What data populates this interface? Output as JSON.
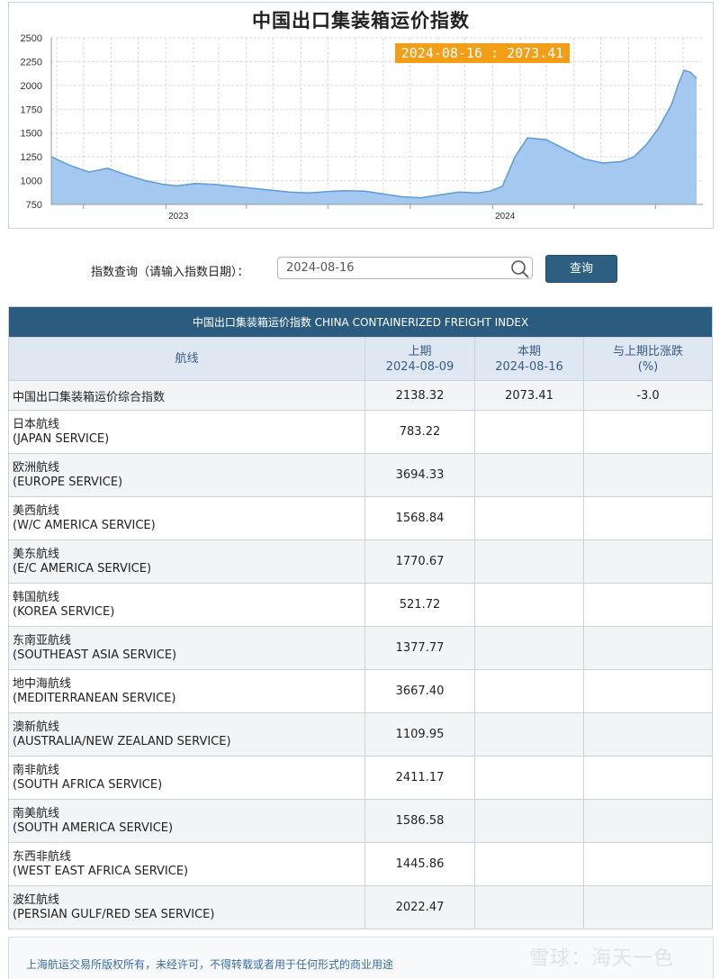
{
  "chart": {
    "title": "中国出口集装箱运价指数",
    "tooltip": "2024-08-16 : 2073.41"
  },
  "chart_data": {
    "type": "area",
    "title": "中国出口集装箱运价指数",
    "ylim": [
      750,
      2500
    ],
    "yticks": [
      750,
      1000,
      1250,
      1500,
      1750,
      2000,
      2250,
      2500
    ],
    "xtick_labels": [
      "2023",
      "2024"
    ],
    "grid": true,
    "color": "#a4c8f0",
    "series": [
      {
        "x": [
          "2022-08-26",
          "2022-09-16",
          "2022-10-07",
          "2022-10-28",
          "2022-11-18",
          "2022-12-09",
          "2022-12-30",
          "2023-01-13",
          "2023-02-03",
          "2023-02-24",
          "2023-03-17",
          "2023-04-07",
          "2023-04-28",
          "2023-05-19",
          "2023-06-09",
          "2023-06-30",
          "2023-07-21",
          "2023-08-11",
          "2023-09-01",
          "2023-09-22",
          "2023-10-13",
          "2023-11-03",
          "2023-11-24",
          "2023-12-15",
          "2023-12-29",
          "2024-01-12",
          "2024-01-26",
          "2024-02-09",
          "2024-03-01",
          "2024-03-22",
          "2024-04-12",
          "2024-05-03",
          "2024-05-24",
          "2024-06-07",
          "2024-06-21",
          "2024-07-05",
          "2024-07-19",
          "2024-07-26",
          "2024-08-02",
          "2024-08-09",
          "2024-08-16"
        ],
        "y": [
          1250,
          1160,
          1090,
          1130,
          1060,
          1000,
          960,
          945,
          970,
          960,
          940,
          920,
          900,
          880,
          870,
          885,
          895,
          890,
          860,
          830,
          820,
          850,
          880,
          870,
          890,
          940,
          1250,
          1450,
          1430,
          1330,
          1230,
          1185,
          1200,
          1250,
          1380,
          1560,
          1800,
          2000,
          2160,
          2138.32,
          2073.41
        ]
      }
    ]
  },
  "query": {
    "label": "指数查询（请输入指数日期）：",
    "date_value": "2024-08-16",
    "button_label": "查询"
  },
  "table": {
    "caption": "中国出口集装箱运价指数 CHINA CONTAINERIZED FREIGHT INDEX",
    "headers": {
      "route": "航线",
      "previous_label": "上期",
      "previous_date": "2024-08-09",
      "current_label": "本期",
      "current_date": "2024-08-16",
      "change_label": "与上期比涨跌",
      "change_unit": "(%)"
    },
    "composite": {
      "name": "中国出口集装箱运价综合指数",
      "previous": "2138.32",
      "current": "2073.41",
      "change": "-3.0"
    },
    "rows": [
      {
        "cn": "日本航线",
        "en": "(JAPAN SERVICE)",
        "previous": "783.22"
      },
      {
        "cn": "欧洲航线",
        "en": "(EUROPE SERVICE)",
        "previous": "3694.33"
      },
      {
        "cn": "美西航线",
        "en": "(W/C AMERICA SERVICE)",
        "previous": "1568.84"
      },
      {
        "cn": "美东航线",
        "en": "(E/C AMERICA SERVICE)",
        "previous": "1770.67"
      },
      {
        "cn": "韩国航线",
        "en": "(KOREA SERVICE)",
        "previous": "521.72"
      },
      {
        "cn": "东南亚航线",
        "en": "(SOUTHEAST ASIA SERVICE)",
        "previous": "1377.77"
      },
      {
        "cn": "地中海航线",
        "en": "(MEDITERRANEAN SERVICE)",
        "previous": "3667.40"
      },
      {
        "cn": "澳新航线",
        "en": "(AUSTRALIA/NEW ZEALAND SERVICE)",
        "previous": "1109.95"
      },
      {
        "cn": "南非航线",
        "en": "(SOUTH AFRICA SERVICE)",
        "previous": "2411.17"
      },
      {
        "cn": "南美航线",
        "en": "(SOUTH AMERICA SERVICE)",
        "previous": "1586.58"
      },
      {
        "cn": "东西非航线",
        "en": "(WEST EAST AFRICA SERVICE)",
        "previous": "1445.86"
      },
      {
        "cn": "波红航线",
        "en": "(PERSIAN GULF/RED SEA SERVICE)",
        "previous": "2022.47"
      }
    ]
  },
  "footer": {
    "copyright": "上海航运交易所版权所有，未经许可，不得转载或者用于任何形式的商业用途",
    "watermark": "雪球：海天一色"
  }
}
